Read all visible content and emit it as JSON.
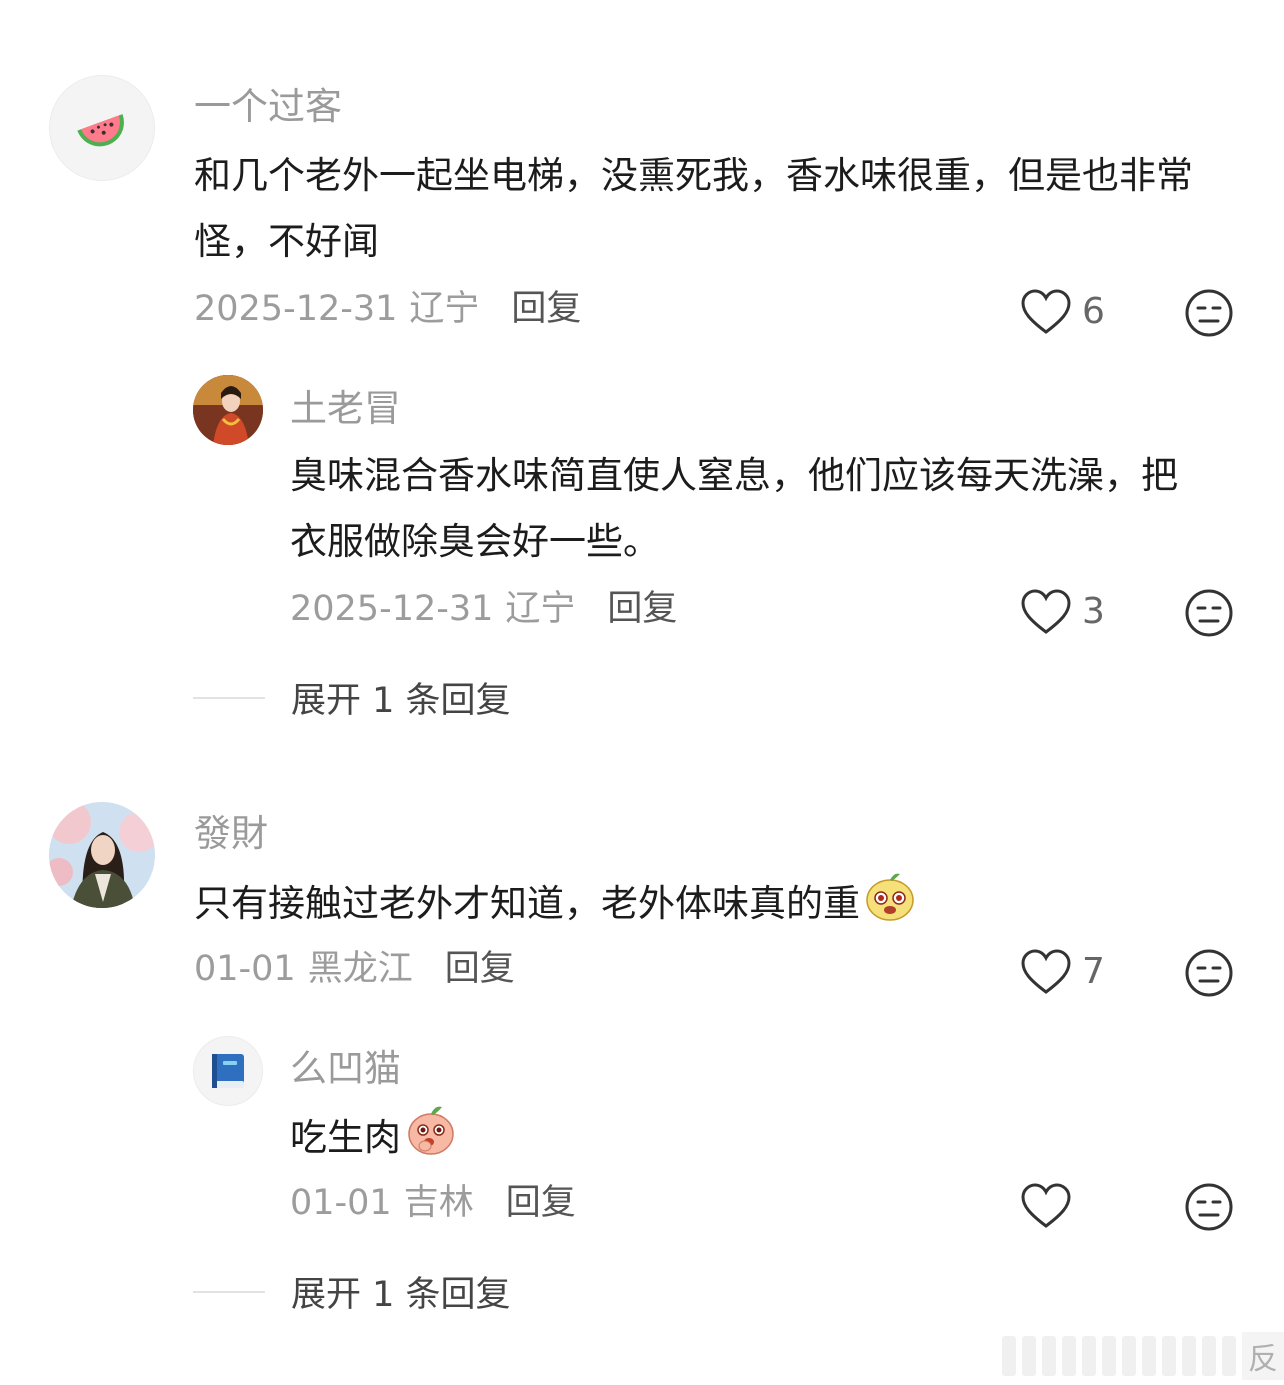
{
  "comments": [
    {
      "username": "一个过客",
      "text": "和几个老外一起坐电梯，没熏死我，香水味很重，但是也非常怪，不好闻",
      "date": "2025-12-31",
      "region": "辽宁",
      "reply_label": "回复",
      "likes": "6",
      "avatar_icon": "watermelon-icon",
      "replies": [
        {
          "username": "土老冒",
          "text": "臭味混合香水味简直使人窒息，他们应该每天洗澡，把衣服做除臭会好一些。",
          "date": "2025-12-31",
          "region": "辽宁",
          "reply_label": "回复",
          "likes": "3",
          "avatar_icon": "portrait-avatar"
        }
      ],
      "expand_label": "展开 1 条回复"
    },
    {
      "username": "發財",
      "text": "只有接触过老外才知道，老外体味真的重",
      "date": "01-01",
      "region": "黑龙江",
      "reply_label": "回复",
      "likes": "7",
      "avatar_icon": "portrait-avatar",
      "emoji": "shocked-sticker",
      "replies": [
        {
          "username": "么凹猫",
          "text": "吃生肉",
          "date": "01-01",
          "region": "吉林",
          "reply_label": "回复",
          "likes": "",
          "avatar_icon": "blue-book-icon",
          "emoji": "peach-sticker"
        }
      ],
      "expand_label": "展开 1 条回复"
    }
  ],
  "watermark": {
    "text": "反"
  },
  "colors": {
    "username": "#9a9a9a",
    "meta": "#9c9c9c",
    "text": "#1c1c1c"
  }
}
